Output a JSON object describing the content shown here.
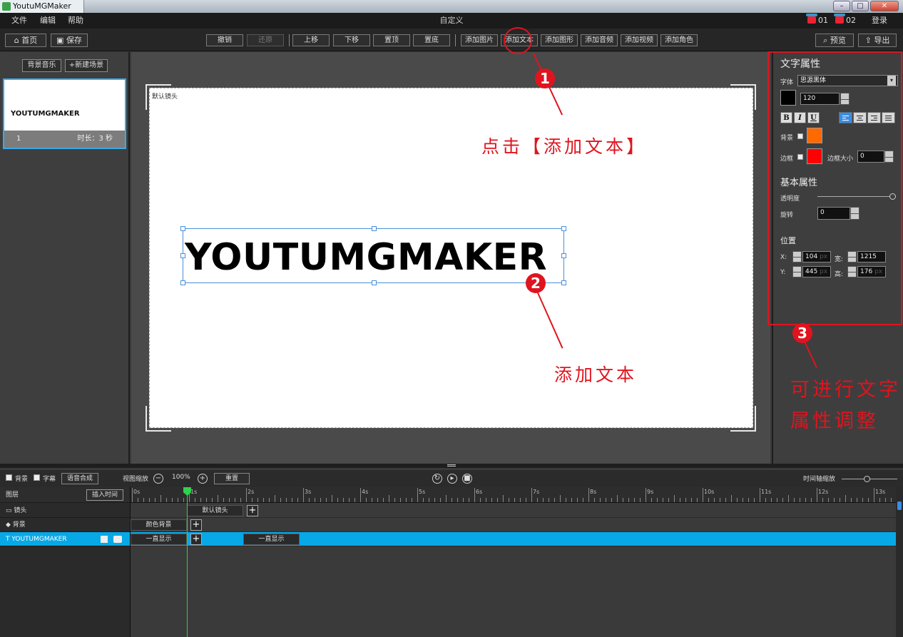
{
  "window": {
    "app_title": "YoutuMGMaker",
    "min": "–",
    "max": "□",
    "close": "✕"
  },
  "menubar": {
    "items": [
      "文件",
      "编辑",
      "帮助"
    ],
    "doc_title": "自定义",
    "project1": "01",
    "project2": "02",
    "login": "登录"
  },
  "toolbar": {
    "home": "首页",
    "save": "保存",
    "undo": "撤销",
    "redo": "还原",
    "move_up": "上移",
    "move_down": "下移",
    "to_top": "置顶",
    "to_bottom": "置底",
    "add_image": "添加图片",
    "add_text": "添加文本",
    "add_shape": "添加图形",
    "add_audio": "添加音频",
    "add_video": "添加视频",
    "add_role": "添加角色",
    "preview": "预览",
    "export": "导出"
  },
  "left_panel": {
    "bg_music": "背景音乐",
    "new_scene": "+新建场景",
    "scene": {
      "thumb_text": "YOUTUMGMAKER",
      "index": "1",
      "duration": "时长：3 秒"
    }
  },
  "canvas": {
    "stage_label": "默认镜头",
    "text": "YOUTUMGMAKER"
  },
  "props": {
    "text_title": "文字属性",
    "font_label": "字体",
    "font_value": "思源黑体",
    "font_size": "120",
    "bold": "B",
    "italic": "I",
    "underline": "U",
    "bg_label": "背景",
    "border_label": "边框",
    "border_size_label": "边框大小",
    "border_size": "0",
    "base_title": "基本属性",
    "opacity_label": "透明度",
    "opacity": 1,
    "rotate_label": "旋转",
    "rotate": "0",
    "pos_title": "位置",
    "x_label": "X:",
    "x": "104",
    "y_label": "Y:",
    "y": "445",
    "w_label": "宽:",
    "w": "1215",
    "h_label": "高:",
    "h": "176",
    "unit": "px",
    "color_text": "#000000",
    "color_bg": "#ff6a00",
    "color_border": "#ff0000"
  },
  "annotations": {
    "step1": "1",
    "step1_text": "点击【添加文本】",
    "step2": "2",
    "step2_text": "添加文本",
    "step3": "3",
    "step3_line1": "可进行文字",
    "step3_line2": "属性调整"
  },
  "timeline": {
    "bg_label": "背景",
    "subtitle_label": "字幕",
    "tts": "语音合成",
    "zoom_label": "视图缩放",
    "zoom_value": "100%",
    "reset": "重置",
    "axis_zoom_label": "时间轴缩放",
    "layers_label": "图层",
    "insert_time": "插入时间",
    "layers": [
      "镜头",
      "背景",
      "YOUTUMGMAKER"
    ],
    "ticks": [
      "0s",
      "1s",
      "2s",
      "3s",
      "4s",
      "5s",
      "6s",
      "7s",
      "8s",
      "9s",
      "10s",
      "11s",
      "12s",
      "13s"
    ],
    "clip_camera": "默认镜头",
    "clip_bg": "颜色背景",
    "clip_text1": "一直显示",
    "clip_text2": "一直显示"
  }
}
